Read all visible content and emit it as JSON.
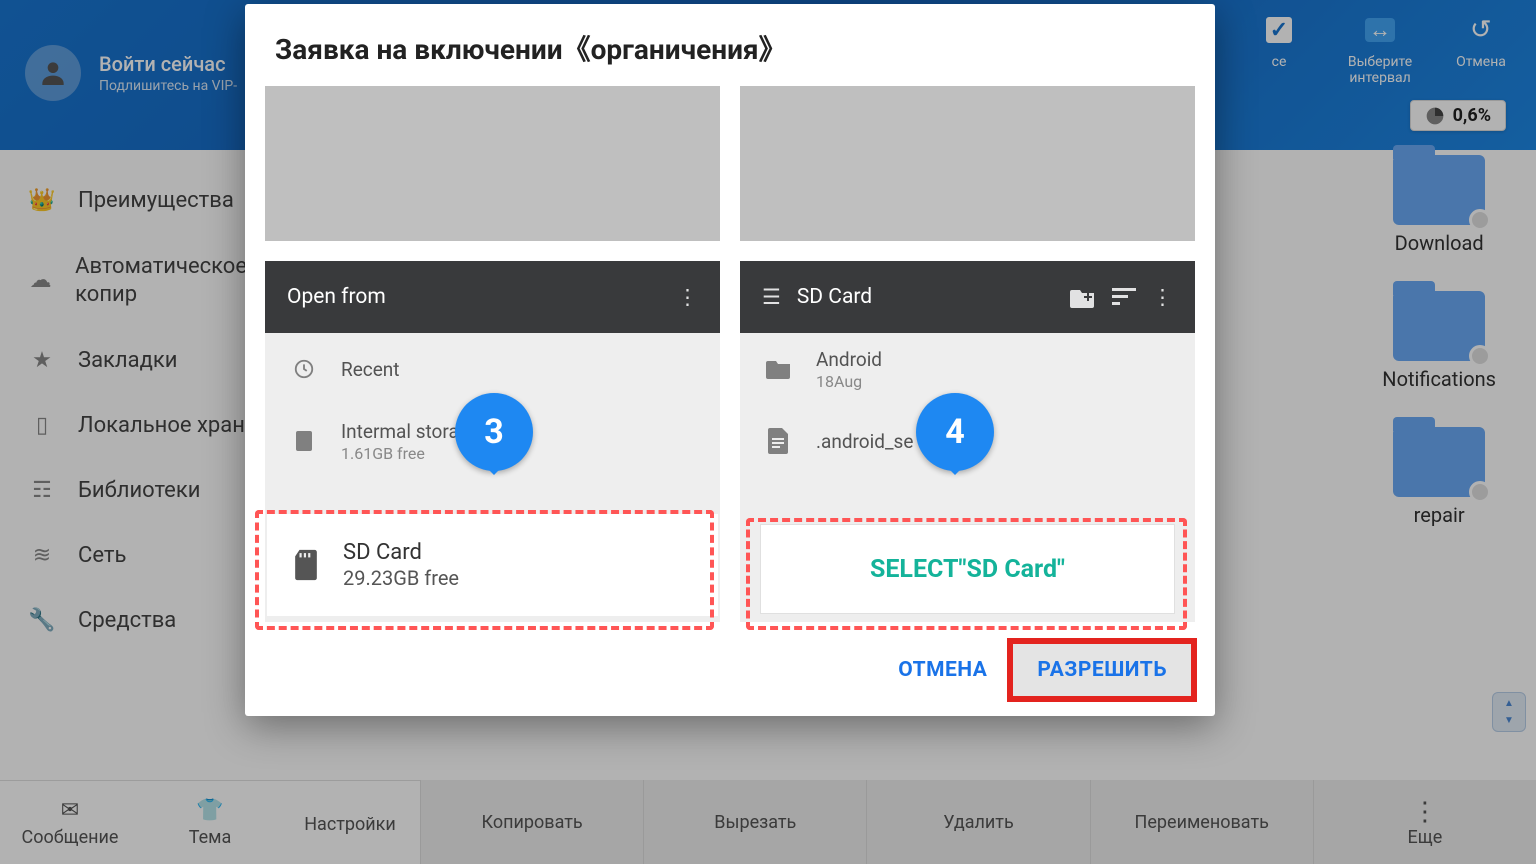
{
  "header": {
    "login_title": "Войти сейчас",
    "login_sub": "Подлишитесь на VIP-",
    "action_checkbox_label": "ce",
    "action_interval": "Выберите интервал",
    "action_cancel": "Отмена",
    "stat_percent": "0,6%"
  },
  "sidebar": {
    "items": [
      {
        "icon": "crown",
        "label": "Преимущества"
      },
      {
        "icon": "cloud",
        "label": "Автоматическое резервное копир"
      },
      {
        "icon": "star",
        "label": "Закладки"
      },
      {
        "icon": "phone",
        "label": "Локальное храни"
      },
      {
        "icon": "layers",
        "label": "Библиотеки"
      },
      {
        "icon": "router",
        "label": "Сеть"
      },
      {
        "icon": "wrench",
        "label": "Средства"
      }
    ]
  },
  "folders": [
    {
      "label": "Download"
    },
    {
      "label": "Notifications"
    },
    {
      "label": "repair"
    }
  ],
  "bottomTabs": [
    {
      "label": "Сообщение"
    },
    {
      "label": "Тема"
    },
    {
      "label": "Настройки"
    }
  ],
  "bottomTools": [
    {
      "label": "Копировать"
    },
    {
      "label": "Вырезать"
    },
    {
      "label": "Удалить"
    },
    {
      "label": "Переименовать"
    },
    {
      "label": "Еще"
    }
  ],
  "dialog": {
    "title": "Заявка на включении《органичения》",
    "cancel": "ОТМЕНА",
    "allow": "РАЗРЕШИТЬ",
    "left": {
      "bar_title": "Open from",
      "recent": "Recent",
      "internal_title": "Intermal stora",
      "internal_free": "1.61GB free",
      "sd_title": "SD Card",
      "sd_free": "29.23GB free",
      "pin": "3"
    },
    "right": {
      "bar_title": "SD Card",
      "android_title": "Android",
      "android_date": "18Aug",
      "secure_title": ".android_se",
      "select_label": "SELECT\"SD Card\"",
      "pin": "4"
    }
  }
}
